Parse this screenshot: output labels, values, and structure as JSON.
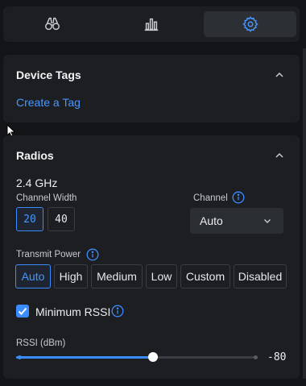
{
  "tabs": [
    {
      "icon": "binoculars-icon",
      "active": false
    },
    {
      "icon": "bar-chart-icon",
      "active": false
    },
    {
      "icon": "gear-icon",
      "active": true
    }
  ],
  "device_tags": {
    "title": "Device Tags",
    "create_link": "Create a Tag"
  },
  "radios": {
    "title": "Radios",
    "band": "2.4 GHz",
    "channel_width": {
      "label": "Channel Width",
      "options": [
        "20",
        "40"
      ],
      "selected": "20"
    },
    "channel": {
      "label": "Channel",
      "value": "Auto"
    },
    "transmit_power": {
      "label": "Transmit Power",
      "options": [
        "Auto",
        "High",
        "Medium",
        "Low",
        "Custom",
        "Disabled"
      ],
      "selected": "Auto"
    },
    "min_rssi": {
      "label": "Minimum RSSI",
      "checked": true
    },
    "rssi": {
      "label": "RSSI (dBm)",
      "value": "-80",
      "slider_fraction": 0.57
    }
  },
  "colors": {
    "accent": "#3b8cff",
    "card": "#1c1e22",
    "background": "#131417"
  }
}
